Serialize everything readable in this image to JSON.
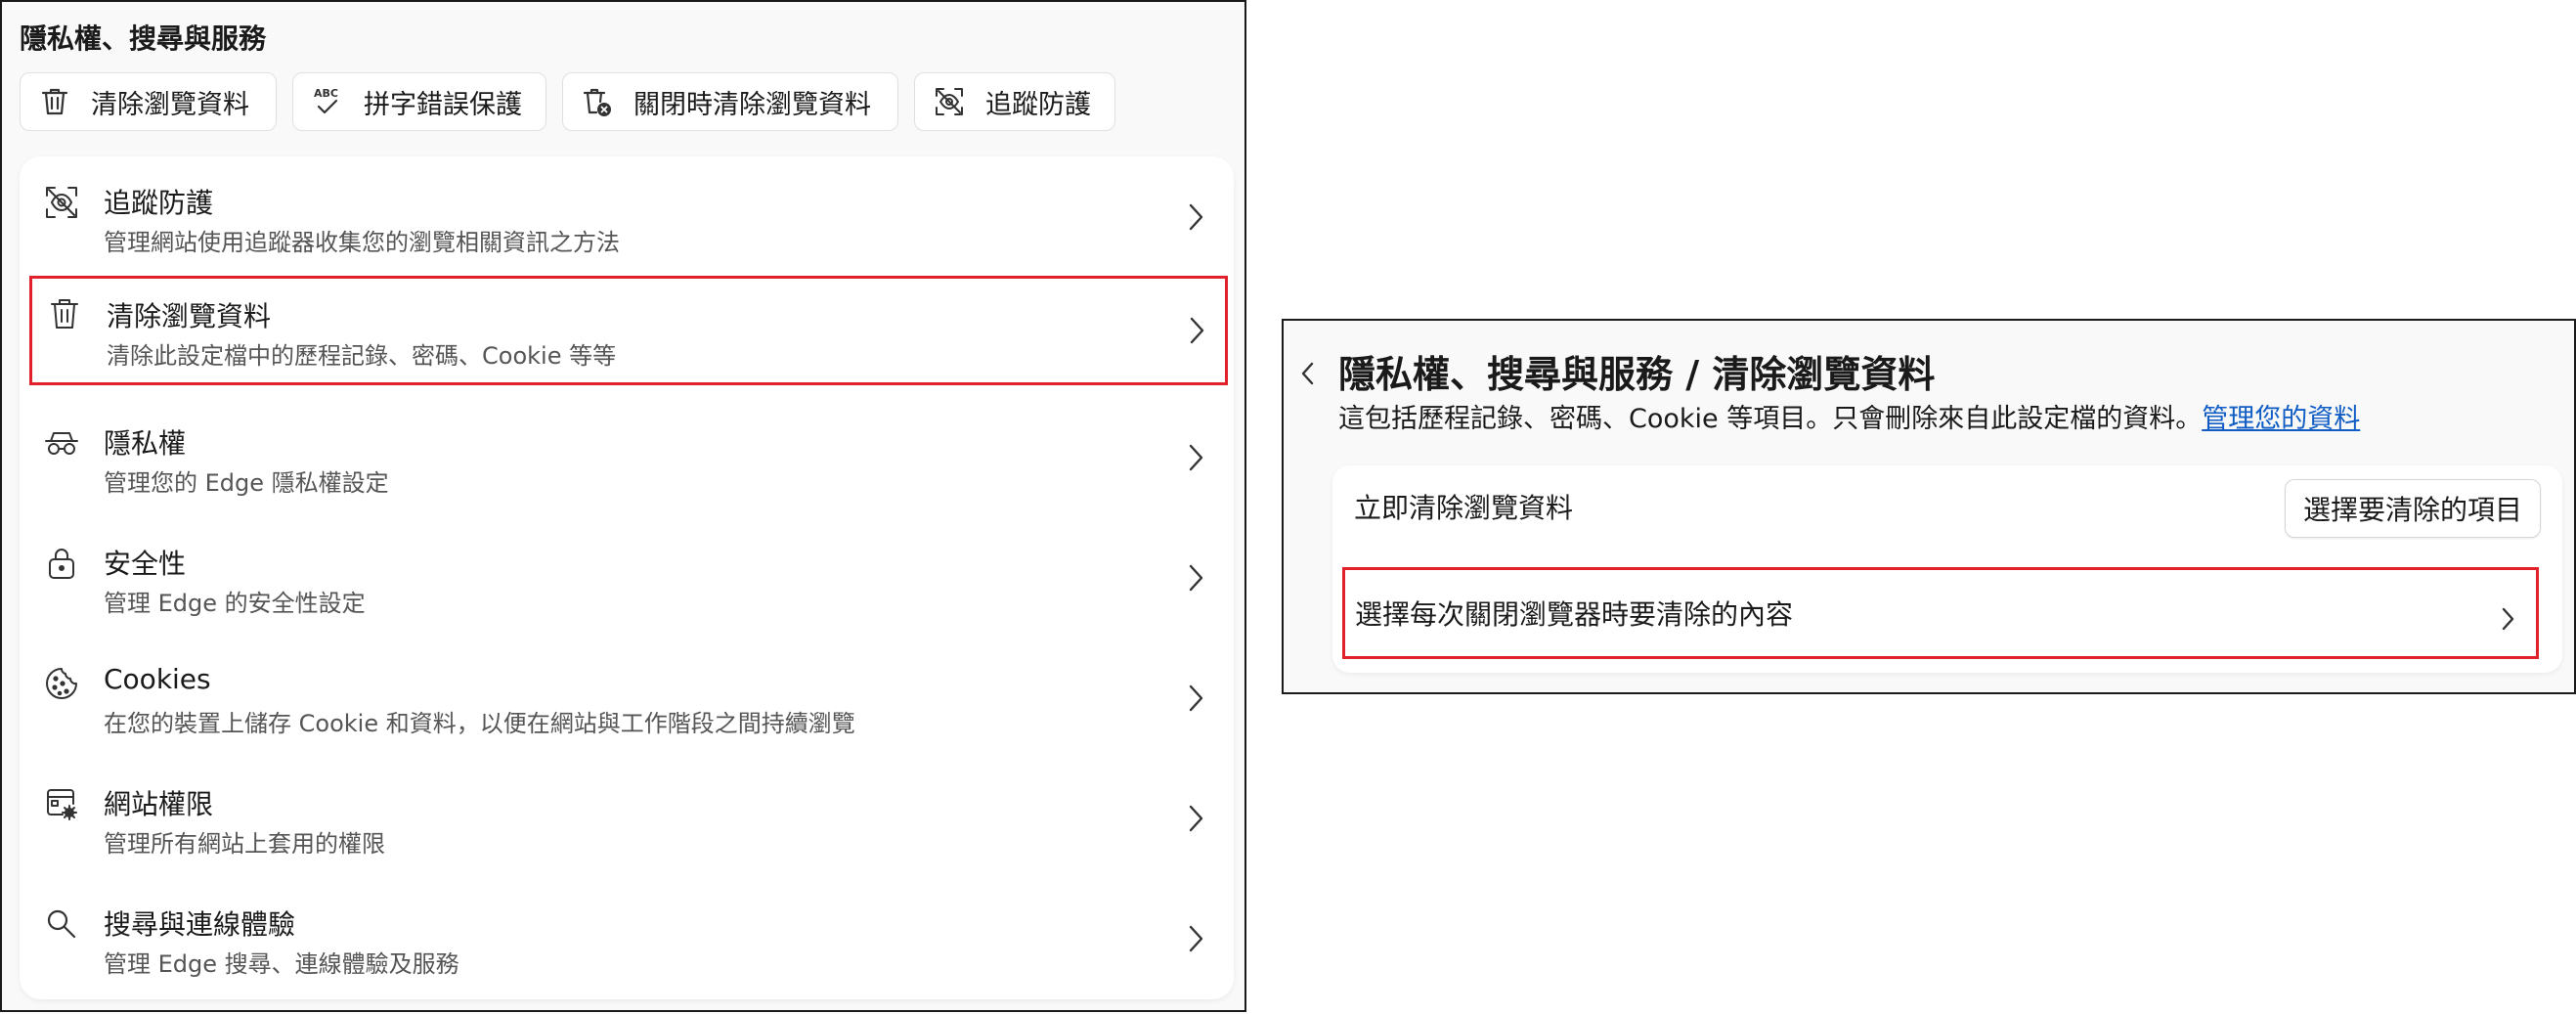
{
  "left_panel": {
    "title": "隱私權、搜尋與服務",
    "quick_buttons": [
      {
        "label": "清除瀏覽資料",
        "icon": "trash-icon"
      },
      {
        "label": "拼字錯誤保護",
        "icon": "spellcheck-icon"
      },
      {
        "label": "關閉時清除瀏覽資料",
        "icon": "trash-clock-icon"
      },
      {
        "label": "追蹤防護",
        "icon": "tracking-prevention-icon"
      }
    ],
    "items": [
      {
        "title": "追蹤防護",
        "desc": "管理網站使用追蹤器收集您的瀏覽相關資訊之方法",
        "icon": "tracking-prevention-icon"
      },
      {
        "title": "清除瀏覽資料",
        "desc": "清除此設定檔中的歷程記錄、密碼、Cookie 等等",
        "icon": "trash-icon",
        "highlighted": true
      },
      {
        "title": "隱私權",
        "desc": "管理您的 Edge 隱私權設定",
        "icon": "privacy-glasses-icon"
      },
      {
        "title": "安全性",
        "desc": "管理 Edge 的安全性設定",
        "icon": "lock-icon"
      },
      {
        "title": "Cookies",
        "desc": "在您的裝置上儲存 Cookie 和資料，以便在網站與工作階段之間持續瀏覽",
        "icon": "cookie-icon"
      },
      {
        "title": "網站權限",
        "desc": "管理所有網站上套用的權限",
        "icon": "site-permissions-icon"
      },
      {
        "title": "搜尋與連線體驗",
        "desc": "管理 Edge 搜尋、連線體驗及服務",
        "icon": "search-icon"
      }
    ]
  },
  "right_panel": {
    "title": "隱私權、搜尋與服務 / 清除瀏覽資料",
    "subtitle": "這包括歷程記錄、密碼、Cookie 等項目。只會刪除來自此設定檔的資料。",
    "subtitle_link": "管理您的資料",
    "clear_now_label": "立即清除瀏覽資料",
    "choose_button": "選擇要清除的項目",
    "on_close_label": "選擇每次關閉瀏覽器時要清除的內容"
  },
  "colors": {
    "highlight_border": "#e0212b",
    "link": "#0f5dc4",
    "panel_bg": "#f9f9f9",
    "card_bg": "#ffffff"
  }
}
